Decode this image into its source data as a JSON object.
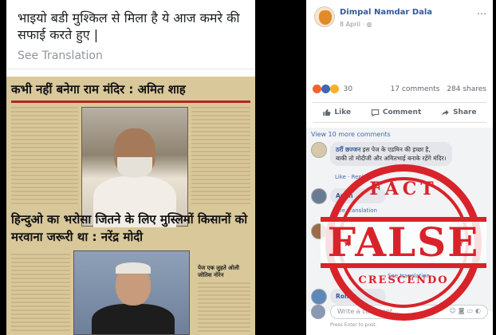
{
  "post_text": {
    "hindi": "भाइयो बडी मुश्किल से मिला है ये आज कमरे की सफाई करते हुए |",
    "see_translation": "See Translation"
  },
  "newspaper": {
    "headline_1": "कभी नहीं बनेगा राम मंदिर : अमित शाह",
    "headline_2": "हिन्दुओ का भरोसा जितने के लिए मुस्लिमों किसानों को मरवाना जरूरी था : नरेंद्र मोदी",
    "side_caption": "पेज एक लुहते ओली जोतिश नोरेन"
  },
  "post": {
    "author": "Dimpal Namdar Dala",
    "date": "8 April",
    "more_icon": "ellipsis-icon",
    "reaction_count": "30",
    "comments_count": "17 comments",
    "shares_count": "284 shares",
    "reaction_colors": {
      "angry": "#f0642f",
      "like": "#4267b2",
      "haha": "#f7b125"
    }
  },
  "actions": {
    "like": "Like",
    "comment": "Comment",
    "share": "Share"
  },
  "comments": {
    "view_more": "View 10 more comments",
    "items": [
      {
        "name": "ठर्री छज्जन",
        "text": "इस पेज के एडमिन की इच्छा है,",
        "text2": "बाकी तो मोदीजी और अमितभाई बनाके रहेंगे मंदिर।",
        "meta": "Like · Reply ·"
      },
      {
        "name": "Anan",
        "text": "",
        "meta": "See translation"
      },
      {
        "name": "Ke",
        "text": "",
        "meta": "See translation"
      },
      {
        "name": "Rohan",
        "text": "",
        "meta": ""
      }
    ]
  },
  "write_comment": {
    "placeholder": "Write a comment...",
    "hint": "Press Enter to post."
  },
  "stamp": {
    "top": "FACT",
    "main": "FALSE",
    "bottom": "CRESCENDO",
    "color": "#d8232a"
  }
}
